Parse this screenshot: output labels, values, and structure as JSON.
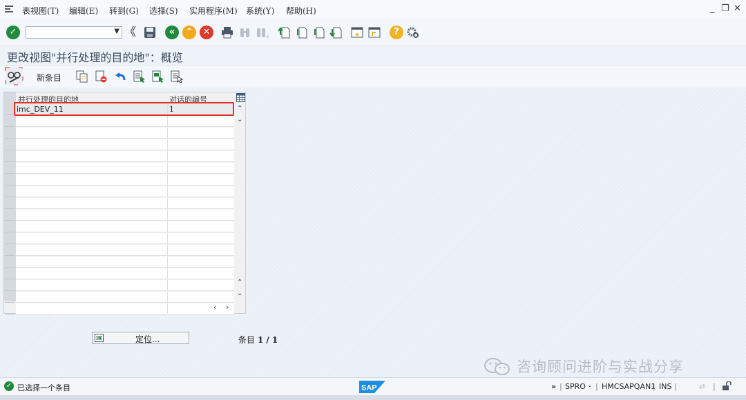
{
  "menu": {
    "items": [
      "表视图(T)",
      "编辑(E)",
      "转到(G)",
      "选择(S)",
      "实用程序(M)",
      "系统(Y)",
      "帮助(H)"
    ]
  },
  "window_controls": {
    "minimize": "_",
    "maximize": "❐",
    "close": "✕"
  },
  "toolbar": {
    "command_field": "",
    "icons": [
      "enter-icon",
      "save-icon",
      "back-icon",
      "exit-icon",
      "cancel-icon",
      "print-icon",
      "find-icon",
      "find-next-icon",
      "first-page-icon",
      "previous-page-icon",
      "next-page-icon",
      "last-page-icon",
      "create-session-icon",
      "shortcut-icon",
      "help-icon",
      "customize-layout-icon"
    ],
    "back_glyph": "《"
  },
  "title": "更改视图\"并行处理的目的地\"：概览",
  "appbar": {
    "new_entry_label": "新条目",
    "icons": [
      "display-change-icon",
      "copy-icon",
      "delete-icon",
      "undo-icon",
      "select-all-icon",
      "select-block-icon",
      "deselect-all-icon"
    ]
  },
  "table": {
    "columns": [
      "并行处理的目的地",
      "对话的编号"
    ],
    "rows": [
      {
        "destination": "imc_DEV_11",
        "dialog_count": "1",
        "selected": true
      }
    ],
    "empty_rows": 17
  },
  "locate_button": {
    "label": "定位..."
  },
  "entry_count": {
    "prefix": "条目",
    "value": "1 / 1"
  },
  "watermark": "咨询顾问进阶与实战分享",
  "status": {
    "message": "已选择一个条目",
    "transaction": "SPRO",
    "server": "HMCSAPQAN1",
    "mode": "INS",
    "logo": "SAP",
    "more": "»"
  },
  "colors": {
    "selection_highlight": "#e03126",
    "ok_green": "#1f8a3b",
    "nav_orange": "#f2a81d",
    "cancel_red": "#d83a2c",
    "help_yellow": "#f0b323",
    "sap_blue": "#1d8fe1"
  }
}
